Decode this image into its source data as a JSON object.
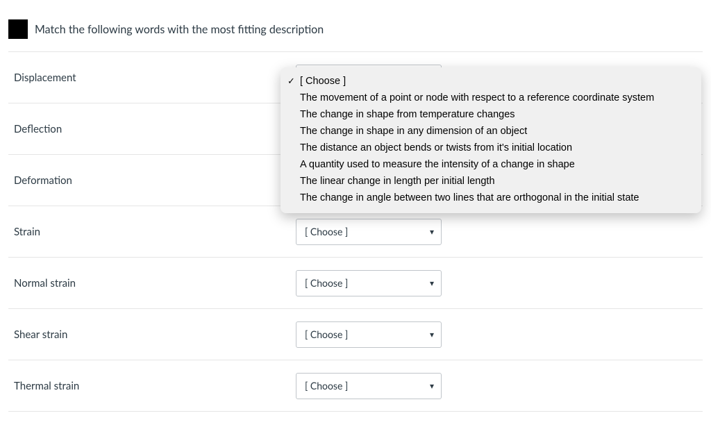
{
  "question": {
    "prompt": "Match the following words with the most fitting description"
  },
  "select_placeholder": "[ Choose ]",
  "terms": [
    {
      "label": "Displacement"
    },
    {
      "label": "Deflection"
    },
    {
      "label": "Deformation"
    },
    {
      "label": "Strain"
    },
    {
      "label": "Normal strain"
    },
    {
      "label": "Shear strain"
    },
    {
      "label": "Thermal strain"
    }
  ],
  "dropdown": {
    "selected_index": 0,
    "options": [
      "[ Choose ]",
      "The movement of a point or node with respect to a reference coordinate system",
      "The change in shape from temperature changes",
      "The change in shape in any dimension of an object",
      "The distance an object bends or twists from it's initial location",
      "A quantity used to measure the intensity of a change in shape",
      "The linear change in length per initial length",
      "The change in angle between two lines that are orthogonal in the initial state"
    ]
  }
}
